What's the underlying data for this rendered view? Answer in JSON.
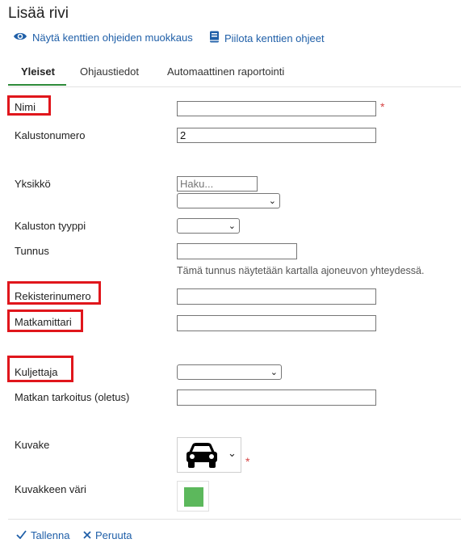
{
  "header": {
    "title": "Lisää rivi",
    "show_help_edit_label": "Näytä kenttien ohjeiden muokkaus",
    "hide_help_label": "Piilota kenttien ohjeet"
  },
  "tabs": [
    {
      "label": "Yleiset",
      "active": true
    },
    {
      "label": "Ohjaustiedot",
      "active": false
    },
    {
      "label": "Automaattinen raportointi",
      "active": false
    }
  ],
  "form": {
    "nimi": {
      "label": "Nimi",
      "value": "",
      "required": true
    },
    "kalustonumero": {
      "label": "Kalustonumero",
      "value": "2"
    },
    "yksikko": {
      "label": "Yksikkö",
      "search_placeholder": "Haku...",
      "selected": ""
    },
    "kaluston_tyyppi": {
      "label": "Kaluston tyyppi",
      "selected": ""
    },
    "tunnus": {
      "label": "Tunnus",
      "value": "",
      "hint": "Tämä tunnus näytetään kartalla ajoneuvon yhteydessä."
    },
    "rekisterinumero": {
      "label": "Rekisterinumero",
      "value": ""
    },
    "matkamittari": {
      "label": "Matkamittari",
      "value": ""
    },
    "kuljettaja": {
      "label": "Kuljettaja",
      "selected": ""
    },
    "matkan_tarkoitus": {
      "label": "Matkan tarkoitus (oletus)",
      "value": ""
    },
    "kuvake": {
      "label": "Kuvake",
      "icon": "car-icon",
      "required": true
    },
    "kuvakkeen_vari": {
      "label": "Kuvakkeen väri",
      "color": "#5cb85c"
    }
  },
  "footer": {
    "save_label": "Tallenna",
    "cancel_label": "Peruuta"
  },
  "colors": {
    "accent": "#2e8b3a",
    "link": "#1f5fa8",
    "highlight": "#e0161c",
    "required": "#d64545"
  }
}
